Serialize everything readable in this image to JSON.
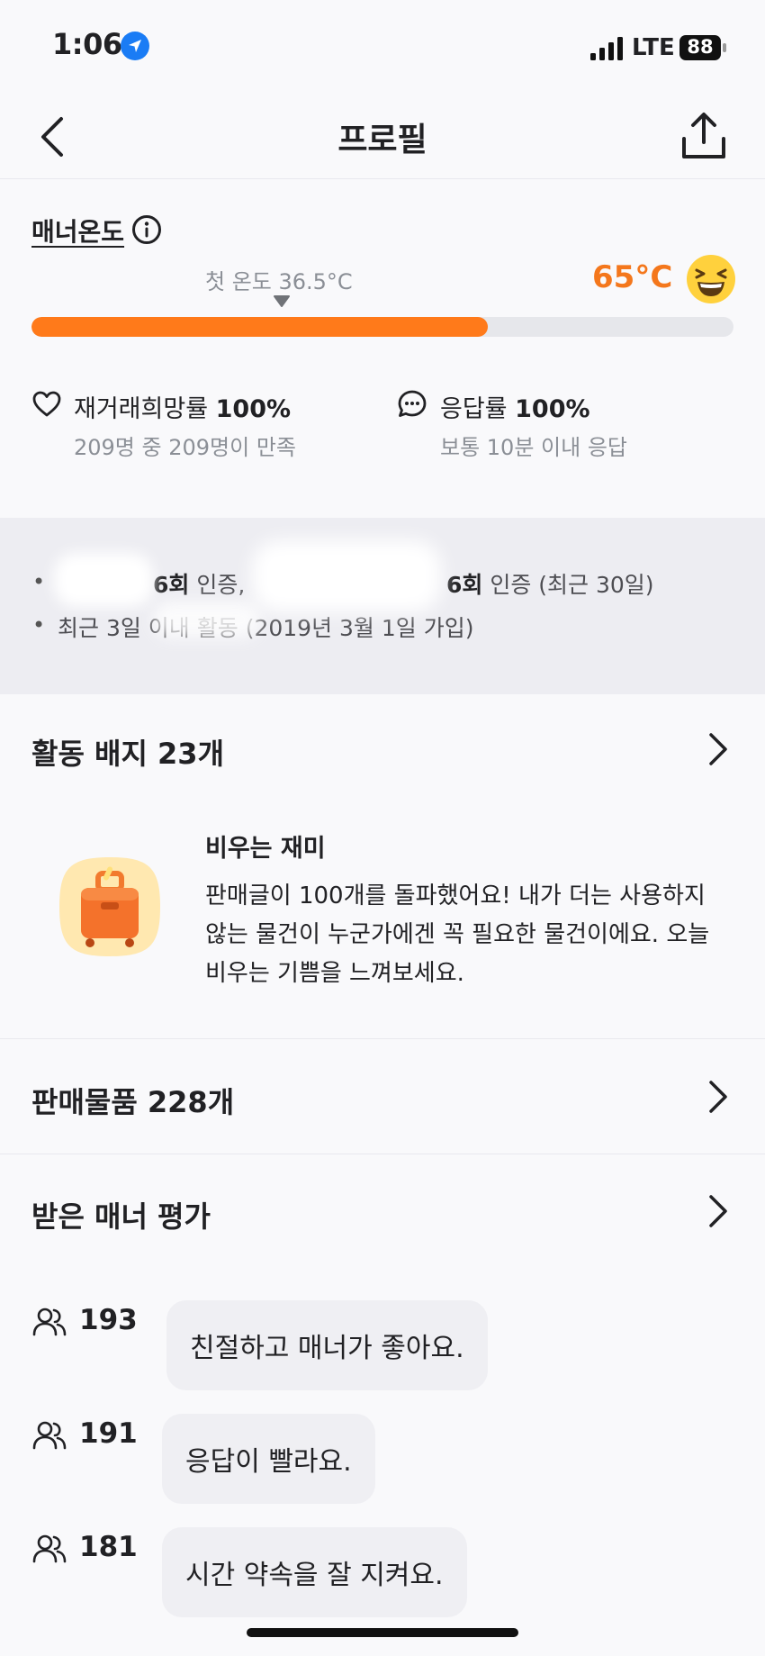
{
  "status_bar": {
    "time": "1:06",
    "network": "LTE",
    "battery": "88"
  },
  "header": {
    "title": "프로필",
    "back_icon": "chevron-left-icon",
    "share_icon": "share-icon"
  },
  "manner": {
    "title": "매너온도",
    "first_temp": "첫 온도 36.5°C",
    "temperature": "65°C",
    "temperature_fraction": 0.65,
    "accent_color": "#ff7a1a",
    "stats": [
      {
        "icon": "heart-icon",
        "label": "재거래희망률",
        "value": "100%",
        "sub": "209명 중 209명이 만족"
      },
      {
        "icon": "chat-bubble-icon",
        "label": "응답률",
        "value": "100%",
        "sub": "보통 10분 이내 응답"
      }
    ]
  },
  "activity_info": {
    "verify_count_1": "6회",
    "verify_text_1": " 인증,",
    "verify_count_2": "6회",
    "verify_text_2": " 인증 (최근 30일)",
    "recent_activity": "최근 3일 이내 활동 (2019년 3월 1일 가입)"
  },
  "badges": {
    "title": "활동 배지 23개",
    "item": {
      "name": "비우는 재미",
      "description": "판매글이 100개를 돌파했어요! 내가 더는 사용하지 않는 물건이 누군가에겐 꼭 필요한 물건이에요. 오늘 비우는 기쁨을 느껴보세요."
    }
  },
  "sales": {
    "title": "판매물품 228개"
  },
  "reviews": {
    "title": "받은 매너 평가",
    "items": [
      {
        "count": "193",
        "text": "친절하고 매너가 좋아요."
      },
      {
        "count": "191",
        "text": "응답이 빨라요."
      },
      {
        "count": "181",
        "text": "시간 약속을 잘 지켜요."
      }
    ]
  }
}
